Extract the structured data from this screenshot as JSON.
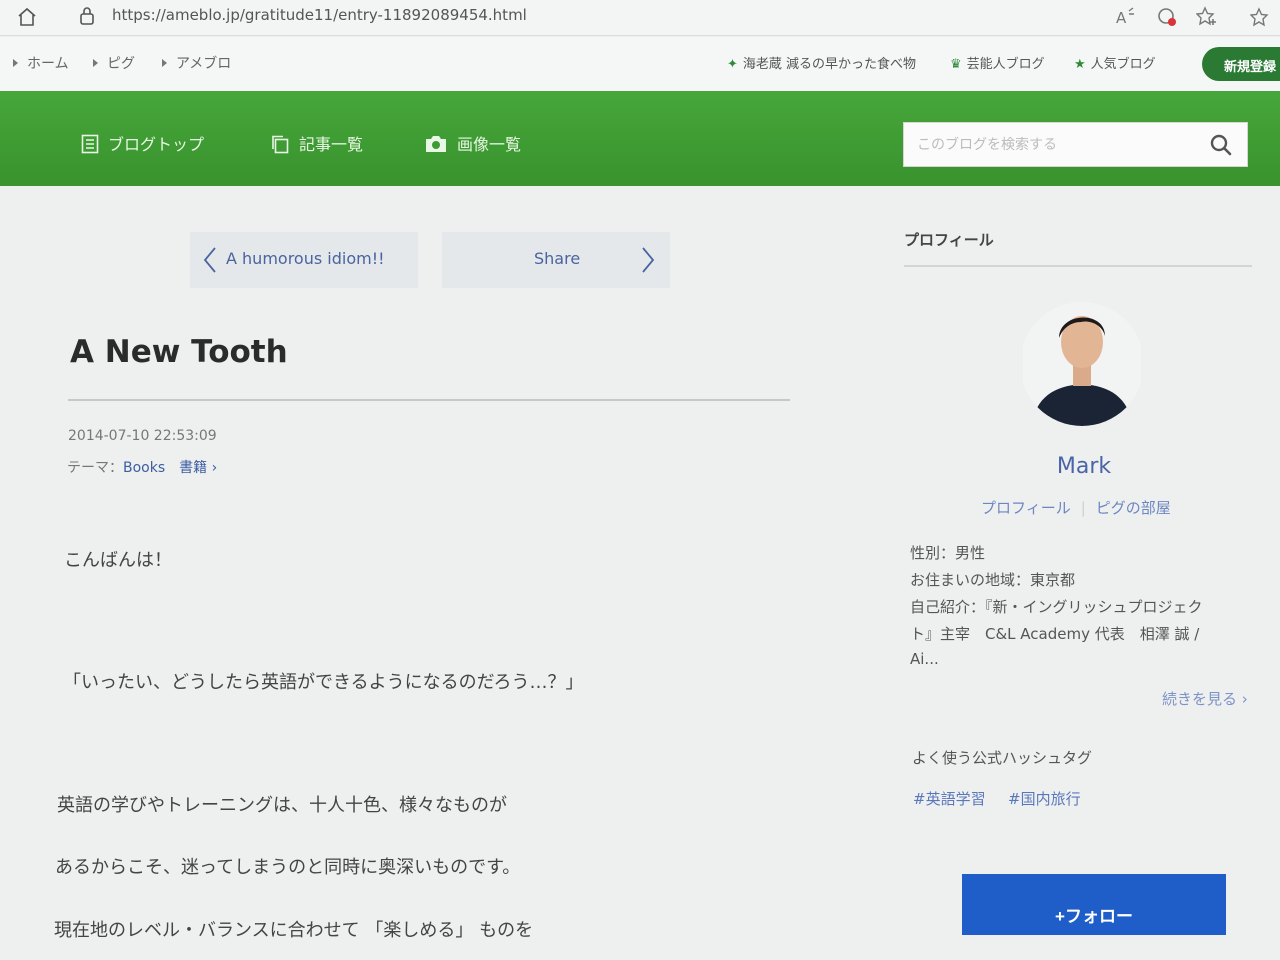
{
  "browser": {
    "url": "https://ameblo.jp/gratitude11/entry-11892089454.html"
  },
  "top_nav": {
    "breadcrumbs": [
      "ホーム",
      "ピグ",
      "アメブロ"
    ],
    "links": [
      {
        "label": "海老蔵 減るの早かった食べ物",
        "icon": "sparkle-icon"
      },
      {
        "label": "芸能人ブログ",
        "icon": "crown-icon"
      },
      {
        "label": "人気ブログ",
        "icon": "star-icon"
      }
    ],
    "signup_label": "新規登録"
  },
  "blog_header": {
    "nav": [
      {
        "label": "ブログトップ",
        "icon": "document-icon"
      },
      {
        "label": "記事一覧",
        "icon": "copy-icon"
      },
      {
        "label": "画像一覧",
        "icon": "camera-icon"
      }
    ],
    "search_placeholder": "このブログを検索する"
  },
  "entry": {
    "prev_label": "A humorous idiom!!",
    "next_label": "Share",
    "title": "A New Tooth",
    "date": "2014-07-10 22:53:09",
    "theme_prefix": "テーマ：",
    "theme_link": "Books　書籍",
    "paragraphs": [
      "こんばんは！",
      "「いったい、どうしたら英語ができるようになるのだろう…？」",
      "英語の学びやトレーニングは、十人十色、様々なものが",
      "あるからこそ、迷ってしまうのと同時に奥深いものです。",
      "現在地のレベル・バランスに合わせて 「楽しめる」 ものを"
    ]
  },
  "sidebar": {
    "heading": "プロフィール",
    "name": "Mark",
    "links": [
      "プロフィール",
      "ピグの部屋"
    ],
    "info": [
      "性別：男性",
      "お住まいの地域：東京都",
      "自己紹介：『新・イングリッシュプロジェク",
      "ト』主宰　C&L Academy 代表　相澤 誠 /",
      "Ai..."
    ],
    "read_more": "続きを見る",
    "hashtag_heading": "よく使う公式ハッシュタグ",
    "hashtags": [
      "#英語学習",
      "#国内旅行"
    ],
    "follow_label": "+フォロー"
  },
  "colors": {
    "header_green": "#3e9a32",
    "follow_blue": "#1f5ec8",
    "link_blue": "#3d5da3"
  }
}
